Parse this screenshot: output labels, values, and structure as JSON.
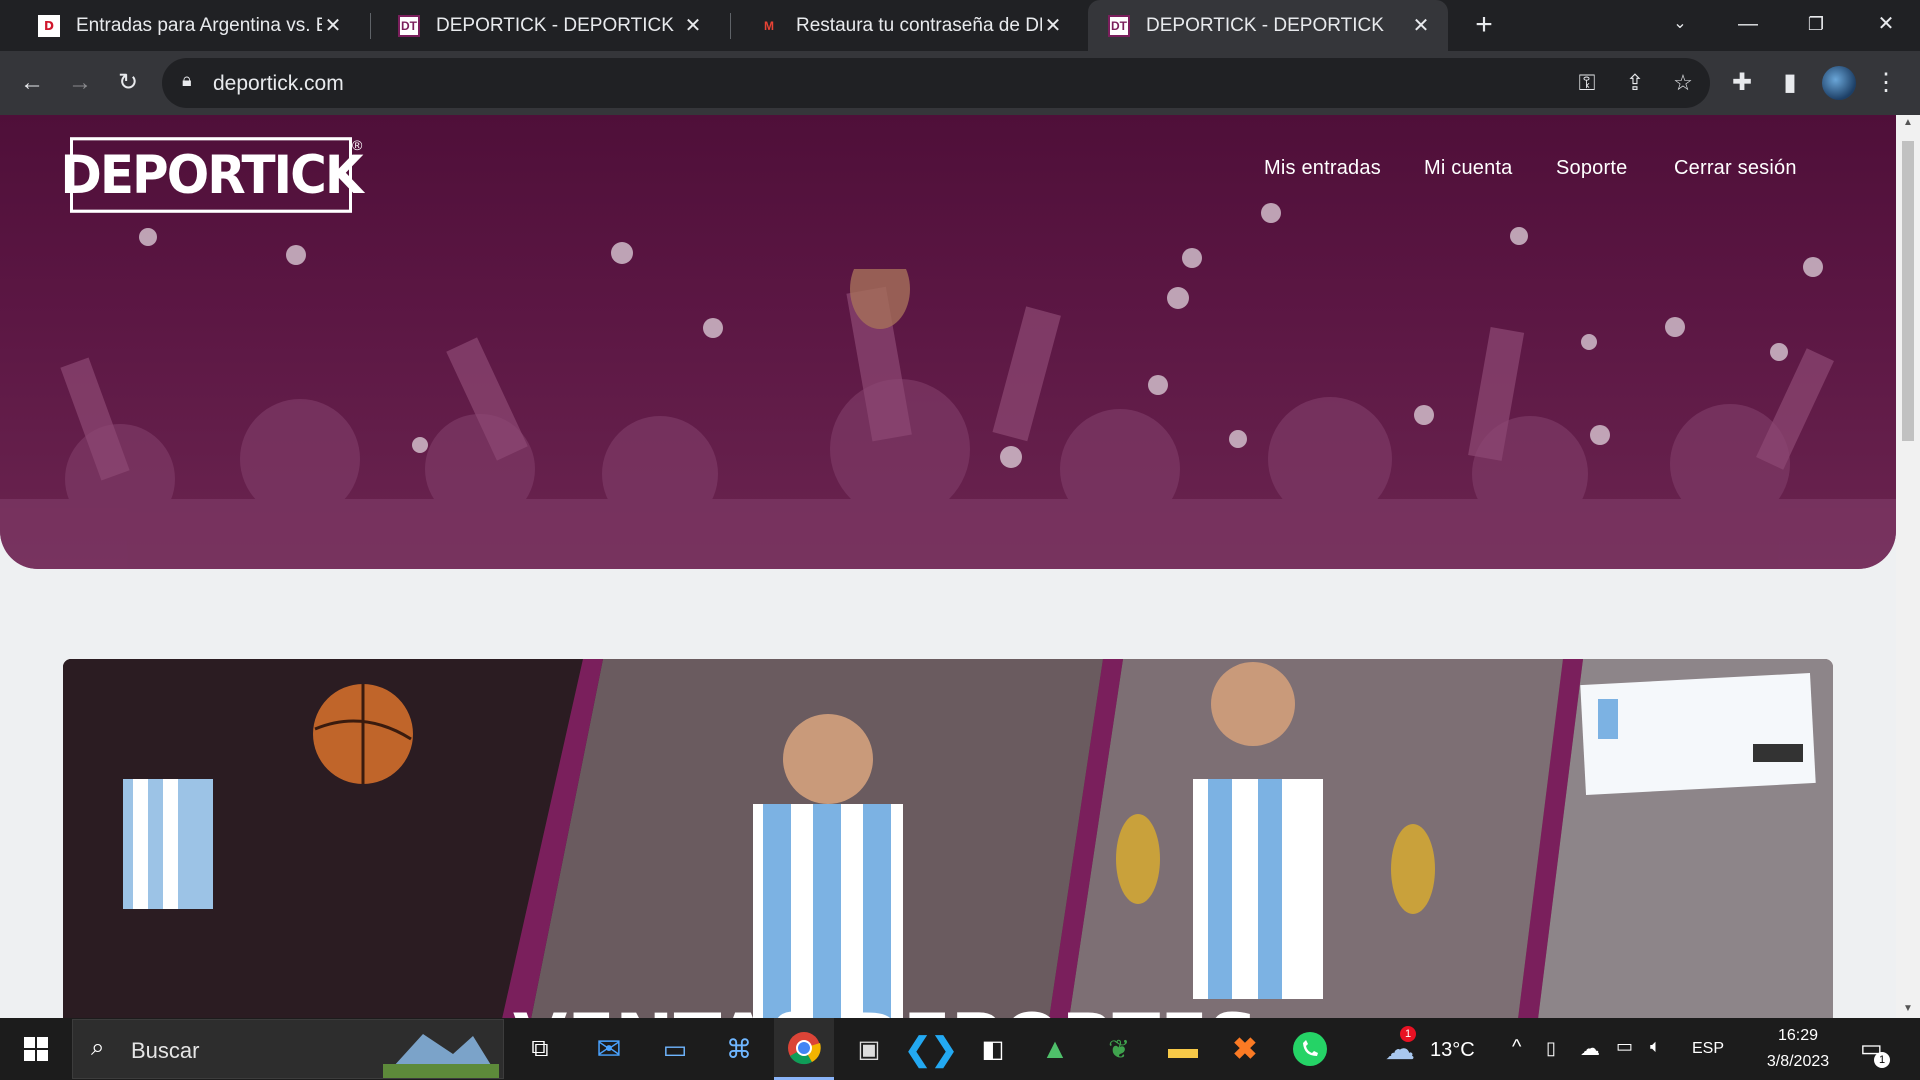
{
  "browser": {
    "tabs": [
      {
        "title": "Entradas para Argentina vs. Ecuador",
        "favicon": "ticket-icon"
      },
      {
        "title": "DEPORTICK - DEPORTICK",
        "favicon": "deportick-icon"
      },
      {
        "title": "Restaura tu contraseña de DEPORTICK",
        "favicon": "gmail-icon"
      },
      {
        "title": "DEPORTICK - DEPORTICK",
        "favicon": "deportick-icon",
        "active": true
      }
    ],
    "url": "deportick.com"
  },
  "site": {
    "logo": "DEPORTICK",
    "logo_reg": "®",
    "nav": [
      "Mis entradas",
      "Mi cuenta",
      "Soporte",
      "Cerrar sesión"
    ],
    "banner_text": "VENTAS DEPORTES"
  },
  "taskbar": {
    "search_placeholder": "Buscar",
    "weather_temp": "13°C",
    "weather_badge": "1",
    "language": "ESP",
    "time": "16:29",
    "date": "3/8/2023",
    "notifications": "1"
  },
  "colors": {
    "hero": "#5c1744",
    "accent": "#7a1f5c"
  }
}
